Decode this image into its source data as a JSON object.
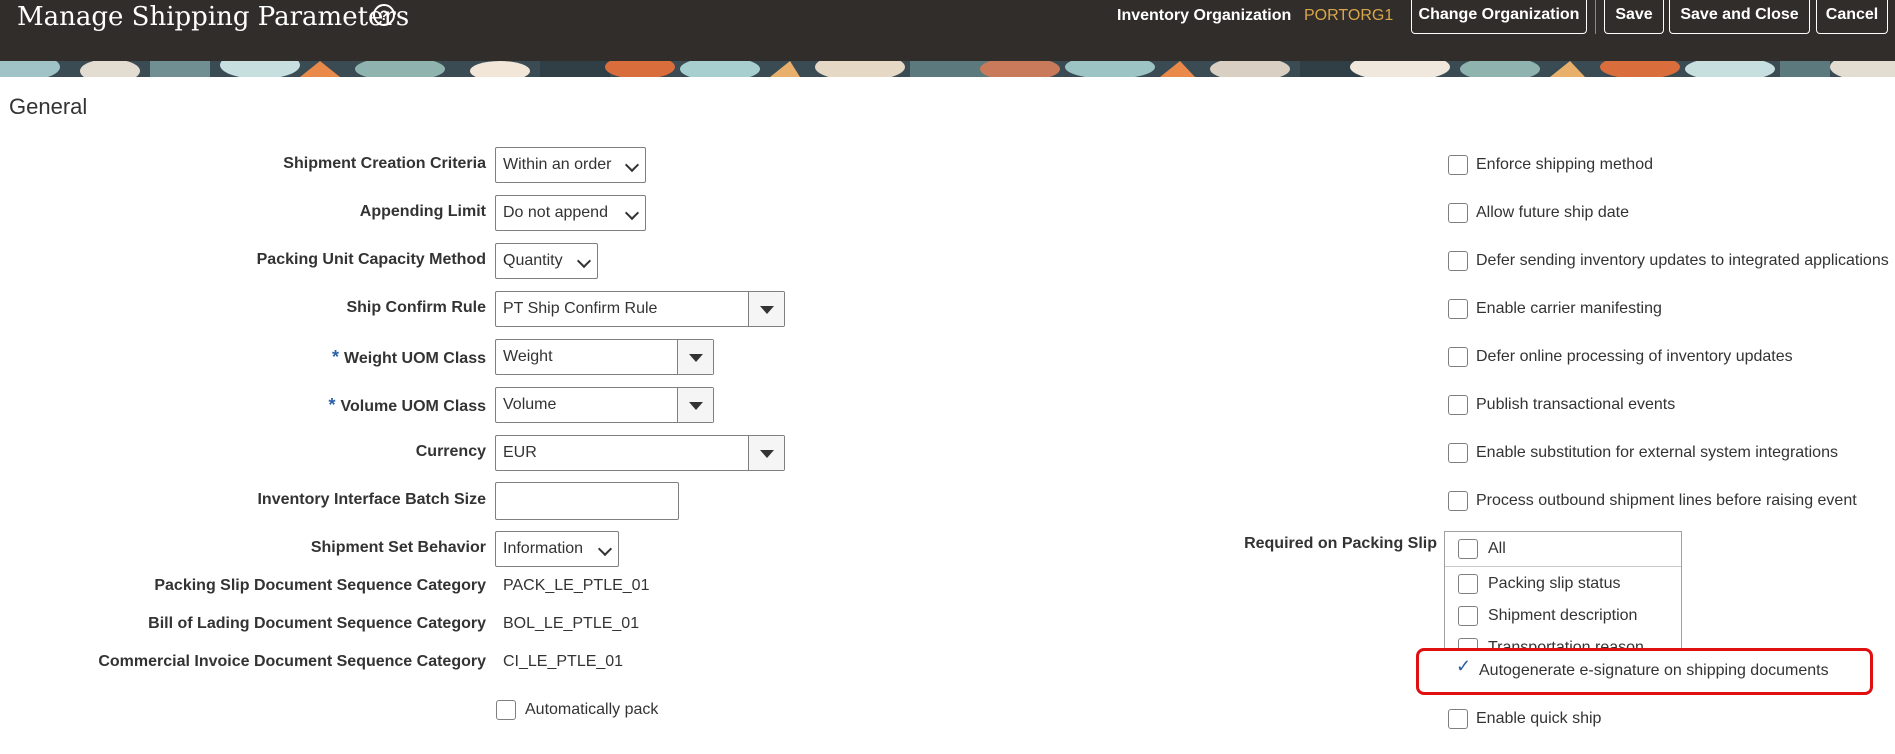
{
  "header": {
    "title": "Manage Shipping Parameters",
    "help_icon": "?",
    "inventory_org_label": "Inventory Organization",
    "inventory_org_value": "PORTORG1",
    "buttons": {
      "change_org": "Change Organization",
      "save": "Save",
      "save_close": "Save and Close",
      "cancel": "Cancel"
    }
  },
  "section": {
    "title": "General"
  },
  "fields": {
    "shipment_creation_criteria": {
      "label": "Shipment Creation Criteria",
      "value": "Within an order"
    },
    "appending_limit": {
      "label": "Appending Limit",
      "value": "Do not append"
    },
    "packing_unit_capacity_method": {
      "label": "Packing Unit Capacity Method",
      "value": "Quantity"
    },
    "ship_confirm_rule": {
      "label": "Ship Confirm Rule",
      "value": "PT Ship Confirm Rule"
    },
    "weight_uom_class": {
      "label": "Weight UOM Class",
      "value": "Weight",
      "required": "*"
    },
    "volume_uom_class": {
      "label": "Volume UOM Class",
      "value": "Volume",
      "required": "*"
    },
    "currency": {
      "label": "Currency",
      "value": "EUR"
    },
    "inventory_interface_batch_size": {
      "label": "Inventory Interface Batch Size",
      "value": ""
    },
    "shipment_set_behavior": {
      "label": "Shipment Set Behavior",
      "value": "Information"
    },
    "packing_slip_doc_seq": {
      "label": "Packing Slip Document Sequence Category",
      "value": "PACK_LE_PTLE_01"
    },
    "bill_of_lading_doc_seq": {
      "label": "Bill of Lading Document Sequence Category",
      "value": "BOL_LE_PTLE_01"
    },
    "commercial_invoice_doc_seq": {
      "label": "Commercial Invoice Document Sequence Category",
      "value": "CI_LE_PTLE_01"
    },
    "automatically_pack": {
      "label": "Automatically pack",
      "checked": false
    }
  },
  "right_options": [
    {
      "label": "Enforce shipping method",
      "checked": false
    },
    {
      "label": "Allow future ship date",
      "checked": false
    },
    {
      "label": "Defer sending inventory updates to integrated applications",
      "checked": false
    },
    {
      "label": "Enable carrier manifesting",
      "checked": false
    },
    {
      "label": "Defer online processing of inventory updates",
      "checked": false
    },
    {
      "label": "Publish transactional events",
      "checked": false
    },
    {
      "label": "Enable substitution for external system integrations",
      "checked": false
    },
    {
      "label": "Process outbound shipment lines before raising event",
      "checked": false
    }
  ],
  "required_on_packing_slip": {
    "label": "Required on Packing Slip",
    "items": [
      {
        "label": "All",
        "checked": false
      },
      {
        "label": "Packing slip status",
        "checked": false
      },
      {
        "label": "Shipment description",
        "checked": false
      },
      {
        "label": "Transportation reason",
        "checked": false
      }
    ]
  },
  "autogenerate_esignature": {
    "label": "Autogenerate e-signature on shipping documents",
    "checked": true
  },
  "enable_quick_ship": {
    "label": "Enable quick ship",
    "checked": false
  },
  "colors": {
    "header_bg": "#312d2a",
    "org_value": "#d9a64b",
    "highlight": "#e01010",
    "required": "#2a5fa8"
  }
}
